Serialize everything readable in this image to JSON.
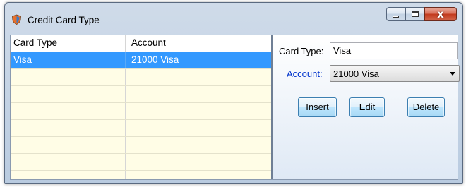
{
  "window": {
    "title": "Credit Card Type",
    "close_glyph": "x",
    "icon": "shield-icon"
  },
  "grid": {
    "columns": [
      "Card Type",
      "Account"
    ],
    "rows": [
      {
        "card_type": "Visa",
        "account": "21000 Visa",
        "selected": true
      }
    ]
  },
  "detail": {
    "card_type_label": "Card Type:",
    "card_type_value": "Visa",
    "account_label": "Account:",
    "account_value": "21000 Visa",
    "buttons": {
      "insert": "Insert",
      "edit": "Edit",
      "delete": "Delete"
    }
  },
  "colors": {
    "selection": "#3399ff",
    "grid_background": "#fffde6",
    "link": "#0033cc"
  }
}
